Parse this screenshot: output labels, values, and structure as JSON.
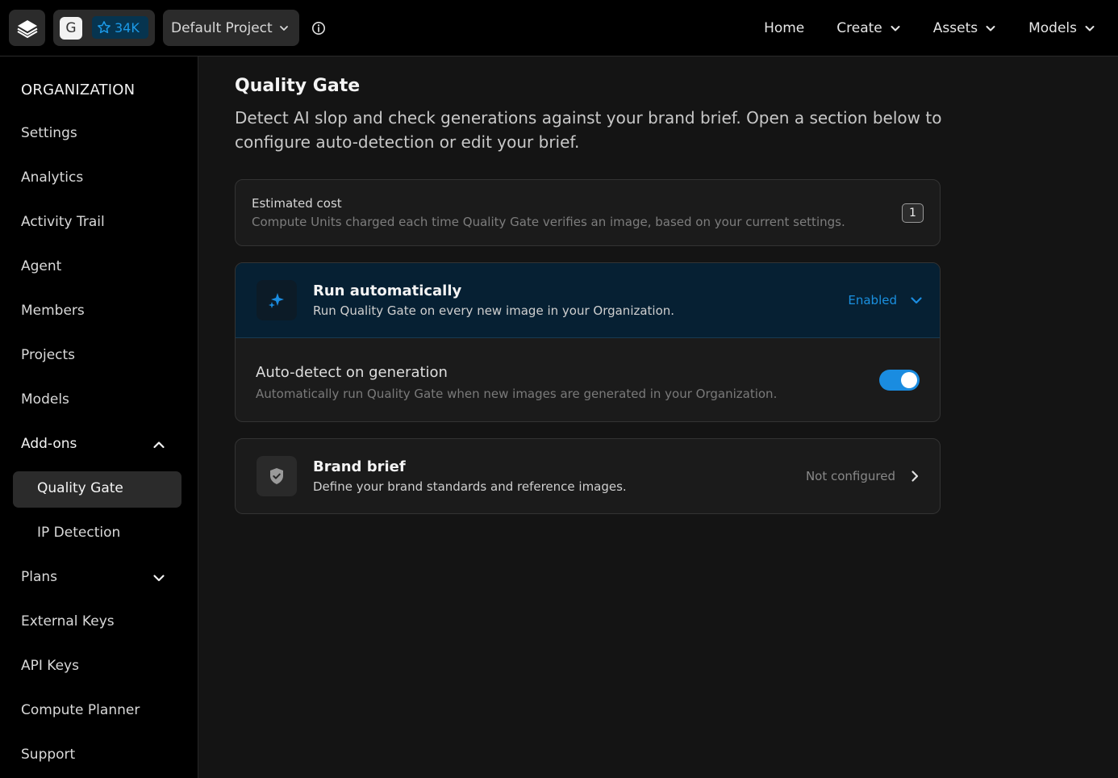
{
  "header": {
    "account_initial": "G",
    "stars": "34K",
    "project": "Default Project",
    "nav": [
      {
        "label": "Home"
      },
      {
        "label": "Create"
      },
      {
        "label": "Assets"
      },
      {
        "label": "Models"
      }
    ]
  },
  "sidebar": {
    "heading": "ORGANIZATION",
    "items": {
      "settings": "Settings",
      "analytics": "Analytics",
      "activity_trail": "Activity Trail",
      "agent": "Agent",
      "members": "Members",
      "projects": "Projects",
      "models": "Models",
      "addons": "Add-ons",
      "quality_gate": "Quality Gate",
      "ip_detection": "IP Detection",
      "plans": "Plans",
      "external_keys": "External Keys",
      "api_keys": "API Keys",
      "compute_planner": "Compute Planner",
      "support": "Support"
    }
  },
  "main": {
    "title": "Quality Gate",
    "description": "Detect AI slop and check generations against your brand brief. Open a section below to configure auto-detection or edit your brief.",
    "cost": {
      "title": "Estimated cost",
      "subtitle": "Compute Units charged each time Quality Gate verifies an image, based on your current settings.",
      "value": "1"
    },
    "run_auto": {
      "title": "Run automatically",
      "subtitle": "Run Quality Gate on every new image in your Organization.",
      "status": "Enabled",
      "setting_title": "Auto-detect on generation",
      "setting_subtitle": "Automatically run Quality Gate when new images are generated in your Organization.",
      "toggle_on": true
    },
    "brand": {
      "title": "Brand brief",
      "subtitle": "Define your brand standards and reference images.",
      "status": "Not configured"
    }
  },
  "colors": {
    "accent": "#1a8ce0",
    "run_header_bg": "#062033",
    "page_bg": "#141414"
  }
}
